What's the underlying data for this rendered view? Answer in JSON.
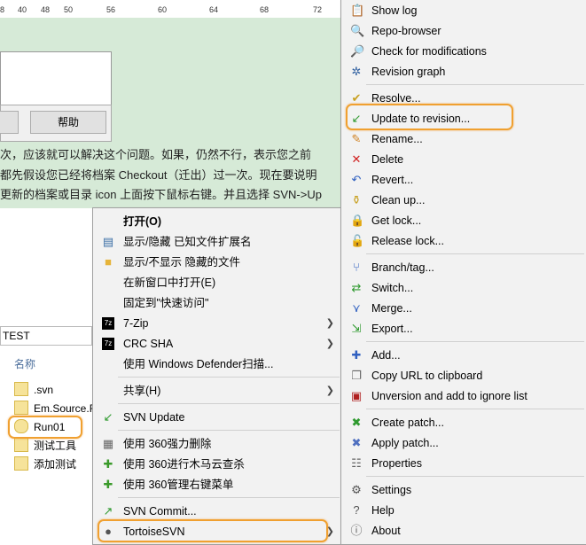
{
  "ruler": {
    "ticks": [
      "8",
      "40",
      "48",
      "50",
      "56",
      "60",
      "64",
      "68",
      "72"
    ]
  },
  "dialog": {
    "help_button": "帮助"
  },
  "doc_text": {
    "line1": "次，应该就可以解决这个问题。如果，仍然不行，表示您之前",
    "line2": "都先假设您已经将档案 Checkout（迁出）过一次。现在要说明",
    "line3": "更新的档案或目录 icon 上面按下鼠标右键。并且选择 SVN->Up"
  },
  "explorer": {
    "address": "TEST",
    "column_name": "名称",
    "files": [
      {
        "name": ".svn"
      },
      {
        "name": "Em.Source.F"
      },
      {
        "name": "Run01"
      },
      {
        "name": "测试工具"
      },
      {
        "name": "添加测试"
      }
    ]
  },
  "main_menu": {
    "items": [
      {
        "label": "打开(O)",
        "icon": ""
      },
      {
        "label": "显示/隐藏 已知文件扩展名",
        "icon": "file-ext-icon"
      },
      {
        "label": "显示/不显示 隐藏的文件",
        "icon": "folder-icon"
      },
      {
        "label": "在新窗口中打开(E)",
        "icon": ""
      },
      {
        "label": "固定到\"快速访问\"",
        "icon": ""
      },
      {
        "label": "7-Zip",
        "icon": "7zip-icon"
      },
      {
        "label": "CRC SHA",
        "icon": "7zip-icon"
      },
      {
        "label": "使用 Windows Defender扫描...",
        "icon": ""
      },
      {
        "label": "共享(H)",
        "icon": ""
      },
      {
        "label": "SVN Update",
        "icon": "svn-update-icon"
      },
      {
        "label": "使用 360强力删除",
        "icon": "shredder-icon"
      },
      {
        "label": "使用 360进行木马云查杀",
        "icon": "360-icon"
      },
      {
        "label": "使用 360管理右键菜单",
        "icon": "360-icon"
      },
      {
        "label": "SVN Commit...",
        "icon": "svn-commit-icon"
      },
      {
        "label": "TortoiseSVN",
        "icon": "tortoise-icon"
      }
    ]
  },
  "svn_menu": {
    "items": [
      {
        "label": "Show log",
        "icon": "log-icon"
      },
      {
        "label": "Repo-browser",
        "icon": "repo-icon"
      },
      {
        "label": "Check for modifications",
        "icon": "modifications-icon"
      },
      {
        "label": "Revision graph",
        "icon": "graph-icon"
      },
      {
        "label": "Resolve...",
        "icon": "resolve-icon"
      },
      {
        "label": "Update to revision...",
        "icon": "update-icon"
      },
      {
        "label": "Rename...",
        "icon": "rename-icon"
      },
      {
        "label": "Delete",
        "icon": "delete-icon"
      },
      {
        "label": "Revert...",
        "icon": "revert-icon"
      },
      {
        "label": "Clean up...",
        "icon": "cleanup-icon"
      },
      {
        "label": "Get lock...",
        "icon": "lock-icon"
      },
      {
        "label": "Release lock...",
        "icon": "unlock-icon"
      },
      {
        "label": "Branch/tag...",
        "icon": "branch-icon"
      },
      {
        "label": "Switch...",
        "icon": "switch-icon"
      },
      {
        "label": "Merge...",
        "icon": "merge-icon"
      },
      {
        "label": "Export...",
        "icon": "export-icon"
      },
      {
        "label": "Add...",
        "icon": "add-icon"
      },
      {
        "label": "Copy URL to clipboard",
        "icon": "copy-url-icon"
      },
      {
        "label": "Unversion and add to ignore list",
        "icon": "ignore-icon"
      },
      {
        "label": "Create patch...",
        "icon": "create-patch-icon"
      },
      {
        "label": "Apply patch...",
        "icon": "apply-patch-icon"
      },
      {
        "label": "Properties",
        "icon": "properties-icon"
      },
      {
        "label": "Settings",
        "icon": "settings-icon"
      },
      {
        "label": "Help",
        "icon": "help-icon"
      },
      {
        "label": "About",
        "icon": "about-icon"
      }
    ]
  },
  "colors": {
    "highlight": "#f0a030",
    "doc_bg": "#d6ead7",
    "menu_bg": "#f2f2f2"
  }
}
